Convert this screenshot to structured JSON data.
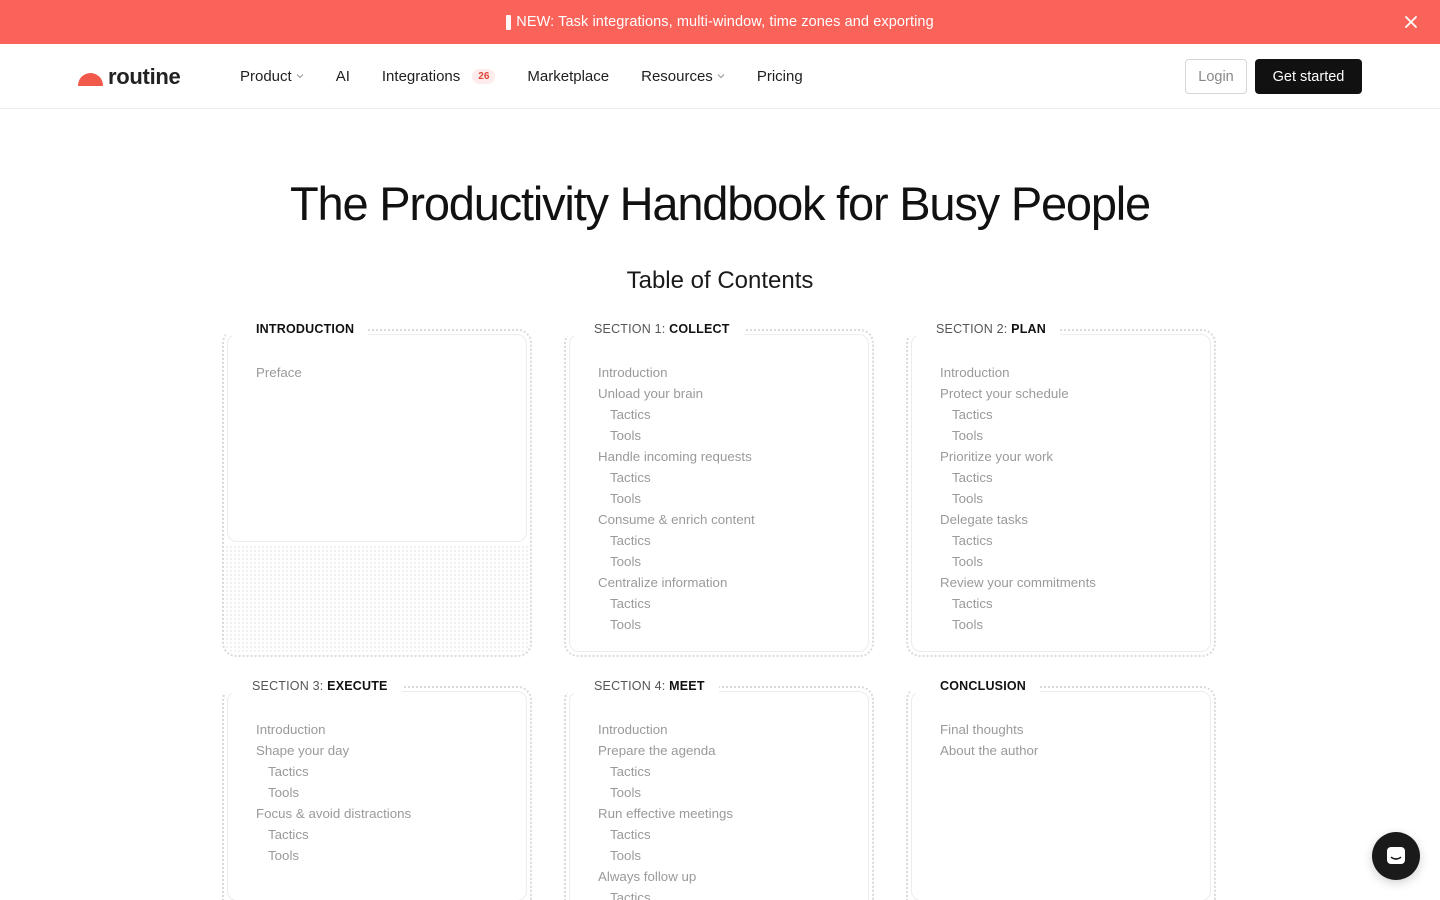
{
  "banner": {
    "text": "NEW: Task integrations, multi-window, time zones and exporting",
    "bg_color": "#fa6359"
  },
  "nav": {
    "logo_text": "routine",
    "items": [
      {
        "label": "Product",
        "has_dropdown": true
      },
      {
        "label": "AI",
        "has_dropdown": false
      },
      {
        "label": "Integrations",
        "badge": "26",
        "has_dropdown": false
      },
      {
        "label": "Marketplace",
        "has_dropdown": false
      },
      {
        "label": "Resources",
        "has_dropdown": true
      },
      {
        "label": "Pricing",
        "has_dropdown": false
      }
    ],
    "login_label": "Login",
    "cta_label": "Get started"
  },
  "page": {
    "title": "The Productivity Handbook for Busy People",
    "toc_title": "Table of Contents"
  },
  "toc": [
    {
      "prefix": "",
      "name": "INTRODUCTION",
      "items": [
        {
          "label": "Preface",
          "sub": false
        }
      ]
    },
    {
      "prefix": "SECTION 1:",
      "name": "COLLECT",
      "items": [
        {
          "label": "Introduction",
          "sub": false
        },
        {
          "label": "Unload your brain",
          "sub": false
        },
        {
          "label": "Tactics",
          "sub": true
        },
        {
          "label": "Tools",
          "sub": true
        },
        {
          "label": "Handle incoming requests",
          "sub": false
        },
        {
          "label": "Tactics",
          "sub": true
        },
        {
          "label": "Tools",
          "sub": true
        },
        {
          "label": "Consume & enrich content",
          "sub": false
        },
        {
          "label": "Tactics",
          "sub": true
        },
        {
          "label": "Tools",
          "sub": true
        },
        {
          "label": "Centralize information",
          "sub": false
        },
        {
          "label": "Tactics",
          "sub": true
        },
        {
          "label": "Tools",
          "sub": true
        }
      ]
    },
    {
      "prefix": "SECTION 2:",
      "name": "PLAN",
      "items": [
        {
          "label": "Introduction",
          "sub": false
        },
        {
          "label": "Protect your schedule",
          "sub": false
        },
        {
          "label": "Tactics",
          "sub": true
        },
        {
          "label": "Tools",
          "sub": true
        },
        {
          "label": "Prioritize your work",
          "sub": false
        },
        {
          "label": "Tactics",
          "sub": true
        },
        {
          "label": "Tools",
          "sub": true
        },
        {
          "label": "Delegate tasks",
          "sub": false
        },
        {
          "label": "Tactics",
          "sub": true
        },
        {
          "label": "Tools",
          "sub": true
        },
        {
          "label": "Review your commitments",
          "sub": false
        },
        {
          "label": "Tactics",
          "sub": true
        },
        {
          "label": "Tools",
          "sub": true
        }
      ]
    },
    {
      "prefix": "SECTION 3:",
      "name": "EXECUTE",
      "items": [
        {
          "label": "Introduction",
          "sub": false
        },
        {
          "label": "Shape your day",
          "sub": false
        },
        {
          "label": "Tactics",
          "sub": true
        },
        {
          "label": "Tools",
          "sub": true
        },
        {
          "label": "Focus & avoid distractions",
          "sub": false
        },
        {
          "label": "Tactics",
          "sub": true
        },
        {
          "label": "Tools",
          "sub": true
        }
      ]
    },
    {
      "prefix": "SECTION 4:",
      "name": "MEET",
      "items": [
        {
          "label": "Introduction",
          "sub": false
        },
        {
          "label": "Prepare the agenda",
          "sub": false
        },
        {
          "label": "Tactics",
          "sub": true
        },
        {
          "label": "Tools",
          "sub": true
        },
        {
          "label": "Run effective meetings",
          "sub": false
        },
        {
          "label": "Tactics",
          "sub": true
        },
        {
          "label": "Tools",
          "sub": true
        },
        {
          "label": "Always follow up",
          "sub": false
        },
        {
          "label": "Tactics",
          "sub": true
        }
      ]
    },
    {
      "prefix": "",
      "name": "CONCLUSION",
      "items": [
        {
          "label": "Final thoughts",
          "sub": false
        },
        {
          "label": "About the author",
          "sub": false
        }
      ]
    }
  ],
  "icons": {
    "banner_flag": "flag-icon",
    "banner_close": "close-icon",
    "dropdown": "chevron-down-icon",
    "chat": "chat-icon"
  },
  "colors": {
    "brand": "#f15a4a",
    "cta": "#111111",
    "muted_text": "#9a9a9a"
  }
}
